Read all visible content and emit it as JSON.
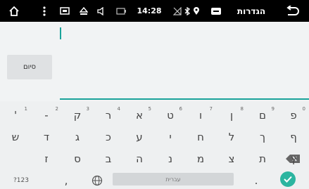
{
  "status_bar": {
    "time": "14:28",
    "title": "הגדרות",
    "icons": [
      "back-icon",
      "more-vert-icon",
      "screenshot-icon",
      "eject-icon",
      "volume-icon",
      "battery-icon",
      "signal-off-icon",
      "bluetooth-icon",
      "location-icon",
      "message-icon",
      "home-icon"
    ]
  },
  "content": {
    "done_label": "סיום"
  },
  "keyboard": {
    "rows": [
      [
        {
          "label": "פ",
          "hint": "0"
        },
        {
          "label": "ם",
          "hint": "9"
        },
        {
          "label": "ן",
          "hint": "8"
        },
        {
          "label": "ו",
          "hint": "7"
        },
        {
          "label": "ט",
          "hint": "6"
        },
        {
          "label": "א",
          "hint": "5"
        },
        {
          "label": "ר",
          "hint": "4"
        },
        {
          "label": "ק",
          "hint": "3"
        },
        {
          "label": "-",
          "hint": "2"
        },
        {
          "label": "'",
          "hint": "1"
        }
      ],
      [
        {
          "label": "ף"
        },
        {
          "label": "ך"
        },
        {
          "label": "ל"
        },
        {
          "label": "ח"
        },
        {
          "label": "י"
        },
        {
          "label": "ע"
        },
        {
          "label": "כ"
        },
        {
          "label": "ג"
        },
        {
          "label": "ד"
        },
        {
          "label": "ש"
        }
      ],
      [
        {
          "label": "ץ"
        },
        {
          "label": "ת"
        },
        {
          "label": "צ"
        },
        {
          "label": "מ"
        },
        {
          "label": "נ"
        },
        {
          "label": "ה"
        },
        {
          "label": "ב"
        },
        {
          "label": "ס"
        },
        {
          "label": "ז"
        }
      ]
    ],
    "symbols_label": "?123",
    "comma": ",",
    "space_label": "עברית",
    "period": "."
  },
  "colors": {
    "accent": "#1aa39a",
    "enter": "#2bb5a0",
    "status_bar": "#000000",
    "keyboard_bg": "#eef0f1"
  }
}
